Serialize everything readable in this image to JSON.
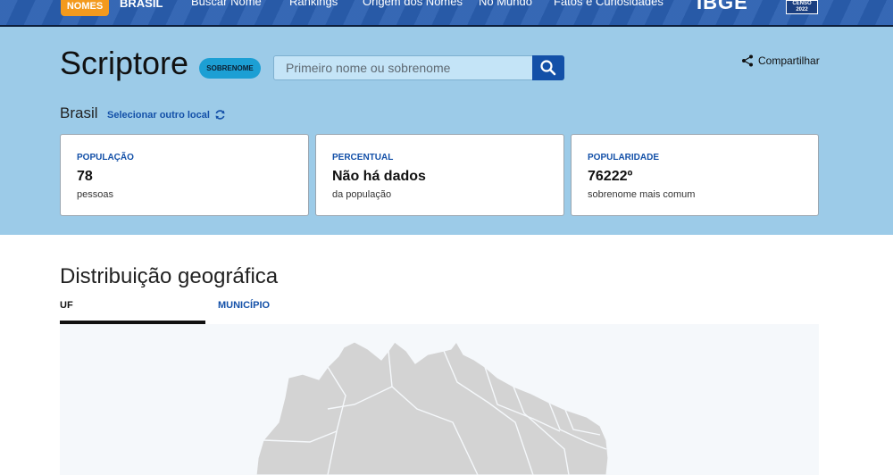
{
  "nav": {
    "logo_badge": "NOMES",
    "logo_text": "BRASIL",
    "items": [
      "Buscar Nome",
      "Rankings",
      "Origem dos Nomes",
      "No Mundo",
      "Fatos e Curiosidades"
    ],
    "ibge": "IBGE",
    "censo": "CENSO 2022"
  },
  "hero": {
    "title": "Scriptore",
    "badge": "SOBRENOME",
    "search_placeholder": "Primeiro nome ou sobrenome",
    "share_label": "Compartilhar",
    "location": "Brasil",
    "change_location": "Selecionar outro local"
  },
  "cards": [
    {
      "label": "POPULAÇÃO",
      "value": "78",
      "sub": "pessoas"
    },
    {
      "label": "PERCENTUAL",
      "value": "Não há dados",
      "sub": "da população"
    },
    {
      "label": "POPULARIDADE",
      "value": "76222º",
      "sub": "sobrenome mais comum"
    }
  ],
  "geo": {
    "title": "Distribuição geográfica",
    "tabs": [
      "UF",
      "MUNICÍPIO"
    ]
  },
  "colors": {
    "hero_bg": "#9ccbe8",
    "accent": "#1350a8",
    "badge": "#1c9fd4",
    "nav_bg": "#2a5fb0",
    "map_fill": "#d3d3d3"
  },
  "icons": {
    "search": "magnifier-icon",
    "share": "share-icon",
    "refresh": "refresh-icon"
  }
}
